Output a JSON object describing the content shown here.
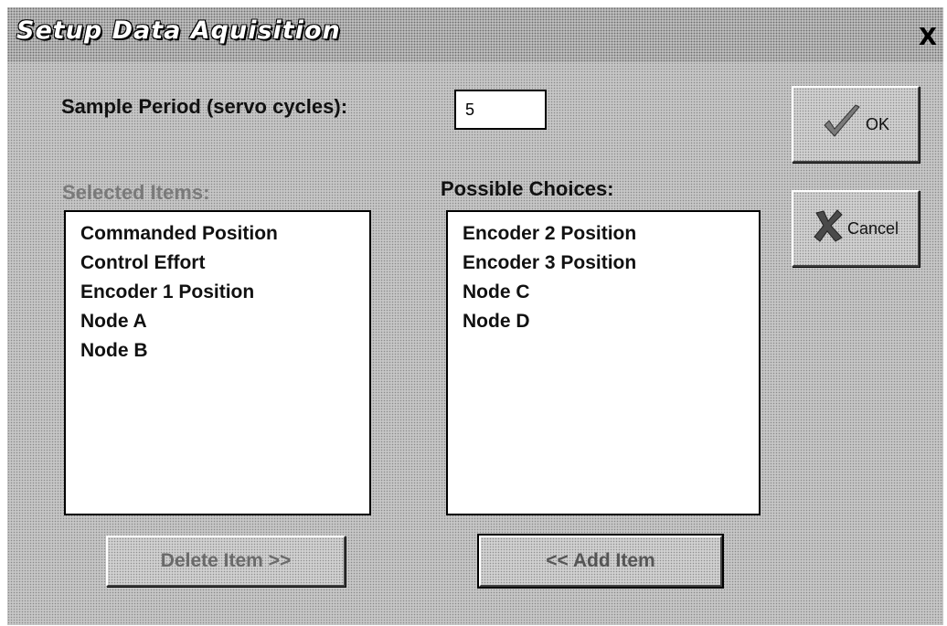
{
  "window": {
    "title": "Setup Data Aquisition",
    "close_glyph": "X"
  },
  "sample_period": {
    "label": "Sample Period (servo cycles):",
    "value": "5"
  },
  "selected_items": {
    "label": "Selected Items:",
    "items": [
      "Commanded Position",
      "Control Effort",
      "Encoder 1 Position",
      "Node A",
      "Node B"
    ]
  },
  "possible_choices": {
    "label": "Possible Choices:",
    "items": [
      "Encoder 2 Position",
      "Encoder 3 Position",
      "Node C",
      "Node D"
    ]
  },
  "buttons": {
    "ok": {
      "label": "OK",
      "icon": "checkmark-icon",
      "icon_color": "#7a7a7a"
    },
    "cancel": {
      "label": "Cancel",
      "icon": "x-mark-icon",
      "icon_color": "#4a4a4a"
    },
    "delete": {
      "label": "Delete Item >>"
    },
    "add": {
      "label": "<< Add Item"
    }
  }
}
